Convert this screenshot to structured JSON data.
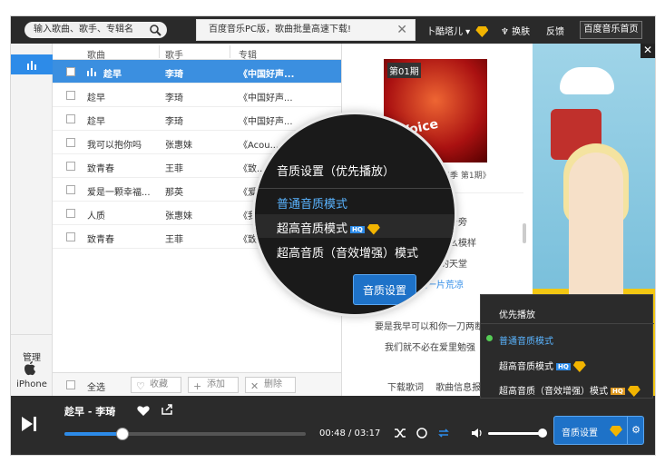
{
  "topbar": {
    "search_placeholder": "输入歌曲、歌手、专辑名",
    "notice": "百度音乐PC版，歌曲批量高速下载!",
    "user": "卜酷塔儿 ▾",
    "skin": "换肤",
    "feedback": "反馈",
    "home": "百度音乐首页"
  },
  "leftnav": {
    "manage": "管理",
    "iphone": "iPhone"
  },
  "table": {
    "headers": [
      "歌曲",
      "歌手",
      "专辑"
    ],
    "rows": [
      {
        "song": "趁早",
        "artist": "李琦",
        "album": "《中国好声..."
      },
      {
        "song": "趁早",
        "artist": "李琦",
        "album": "《中国好声..."
      },
      {
        "song": "趁早",
        "artist": "李琦",
        "album": "《中国好声..."
      },
      {
        "song": "我可以抱你吗",
        "artist": "张惠妹",
        "album": "《Acou..."
      },
      {
        "song": "致青春",
        "artist": "王菲",
        "album": "《致..."
      },
      {
        "song": "爱是一颗幸福...",
        "artist": "那英",
        "album": "《爱..."
      },
      {
        "song": "人质",
        "artist": "张惠妹",
        "album": "《我..."
      },
      {
        "song": "致青春",
        "artist": "王菲",
        "album": "《致青..."
      }
    ],
    "select_all": "全选",
    "collect": "收藏",
    "add": "添加",
    "delete": "删除"
  },
  "middle": {
    "album_title": "《中国好声音第二季 第1期》",
    "album_badge": "第01期",
    "album_art_text": "Voice",
    "lyrics": [
      "在你身旁",
      "是什么模样",
      "我的天堂",
      "其实是一片荒凉",
      "要是我早可以和你一刀两断",
      "我们就不必在爱里勉强"
    ],
    "download_lyrics": "下载歌词",
    "song_info": "歌曲信息报..."
  },
  "ad": {
    "close": "✕"
  },
  "player": {
    "title": "趁早 - 李琦",
    "time": "00:48 / 03:17",
    "progress": 0.24,
    "quality_button": "音质设置"
  },
  "quality_menu": {
    "header": "优先播放",
    "items": [
      "普通音质模式",
      "超高音质模式",
      "超高音质（音效增强）模式"
    ],
    "hq_badge": "HQ"
  },
  "magnifier": {
    "header": "音质设置（优先播放）",
    "items": [
      "普通音质模式",
      "超高音质模式",
      "超高音质（音效增强）模式"
    ],
    "button": "音质设置",
    "hq_badge": "HQ"
  },
  "colors": {
    "accent": "#2d8be8",
    "dark": "#2b2b2b",
    "vip": "#f2b400"
  }
}
